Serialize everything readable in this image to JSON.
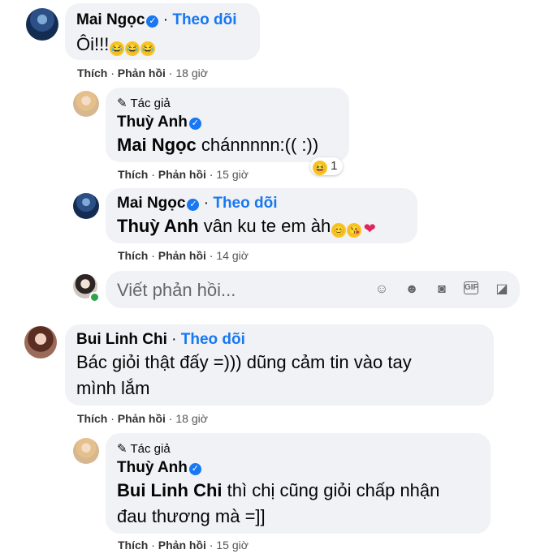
{
  "comment1": {
    "author": "Mai Ngọc",
    "follow": "Theo dõi",
    "text": "Ôi!!!",
    "actions": {
      "like": "Thích",
      "reply": "Phản hồi",
      "time": "18 giờ"
    }
  },
  "reply1a": {
    "author_tag": "Tác giả",
    "author": "Thuỳ Anh",
    "mention": "Mai Ngọc",
    "text": " chánnnnn:(( :))",
    "reaction_count": "1",
    "actions": {
      "like": "Thích",
      "reply": "Phản hồi",
      "time": "15 giờ"
    }
  },
  "reply1b": {
    "author": "Mai Ngọc",
    "follow": "Theo dõi",
    "mention": "Thuỳ Anh",
    "text": " vân ku te em àh",
    "actions": {
      "like": "Thích",
      "reply": "Phản hồi",
      "time": "14 giờ"
    }
  },
  "reply_input": {
    "placeholder": "Viết phản hồi..."
  },
  "comment2": {
    "author": "Bui Linh Chi",
    "follow": "Theo dõi",
    "text_line1": "Bác giỏi thật đấy =))) dũng cảm tin vào tay",
    "text_line2": "mình lắm",
    "actions": {
      "like": "Thích",
      "reply": "Phản hồi",
      "time": "18 giờ"
    }
  },
  "reply2a": {
    "author_tag": "Tác giả",
    "author": "Thuỳ Anh",
    "mention": "Bui Linh Chi",
    "text_line1": " thì chị cũng giỏi chấp nhận",
    "text_line2": "đau thương mà =]]",
    "actions": {
      "like": "Thích",
      "reply": "Phản hồi",
      "time": "15 giờ"
    }
  },
  "colors": {
    "link_blue": "#1877f2",
    "bubble": "#f0f2f5",
    "online": "#31a24c"
  }
}
